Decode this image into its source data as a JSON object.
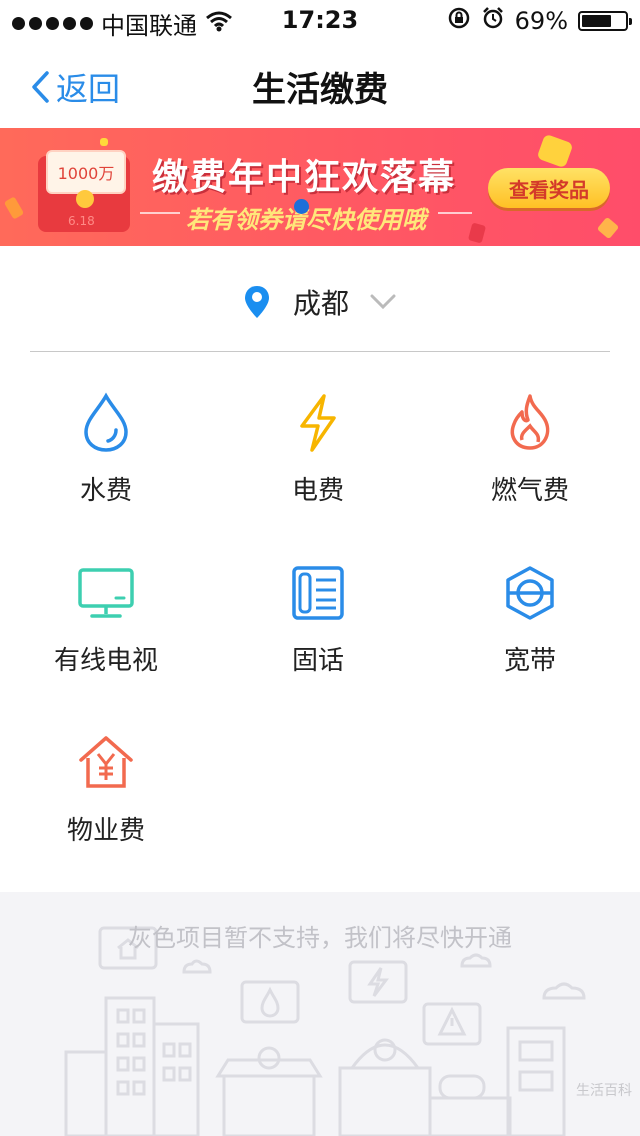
{
  "status_bar": {
    "carrier": "中国联通",
    "time": "17:23",
    "battery": "69%",
    "battery_level": 0.69
  },
  "nav": {
    "back_label": "返回",
    "title": "生活缴费"
  },
  "banner": {
    "card_text": "1000万",
    "envelope_amount": "6.18",
    "headline": "缴费年中狂欢落幕",
    "subline": "若有领券请尽快使用哦",
    "button_label": "查看奖品",
    "colors": {
      "bg": "#ff5a62",
      "button": "#ffd03a"
    }
  },
  "location": {
    "city": "成都",
    "icon": "location-pin-icon",
    "dropdown_icon": "chevron-down-icon"
  },
  "services": [
    {
      "label": "水费",
      "icon": "water-drop-icon",
      "color": "#2a8ce8"
    },
    {
      "label": "电费",
      "icon": "lightning-icon",
      "color": "#f7b500"
    },
    {
      "label": "燃气费",
      "icon": "flame-icon",
      "color": "#f26a4f"
    },
    {
      "label": "有线电视",
      "icon": "tv-icon",
      "color": "#3dcfb0"
    },
    {
      "label": "固话",
      "icon": "telephone-icon",
      "color": "#2a8ce8"
    },
    {
      "label": "宽带",
      "icon": "broadband-icon",
      "color": "#2a8ce8"
    },
    {
      "label": "物业费",
      "icon": "house-yuan-icon",
      "color": "#f26a4f"
    }
  ],
  "footer": {
    "note": "灰色项目暂不支持，我们将尽快开通",
    "watermark": "生活百科"
  }
}
